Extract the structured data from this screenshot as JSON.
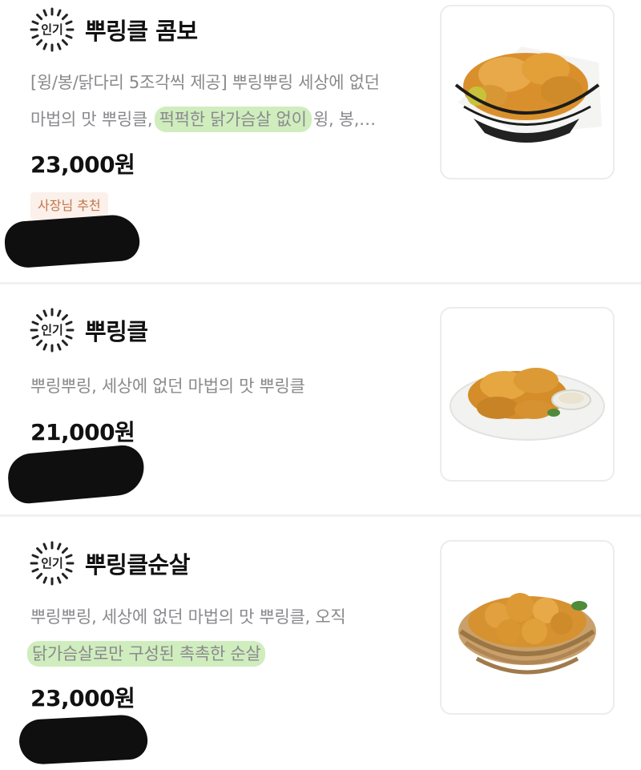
{
  "menu": {
    "items": [
      {
        "badge": "인기",
        "name": "뿌링클 콤보",
        "desc_lines": [
          "[윙/봉/닭다리 5조각씩 제공] 뿌링뿌링 세상에 없던",
          "마법의 맛 뿌링클, ",
          "퍽퍽한 닭가슴살 없이",
          " 윙, 봉,…"
        ],
        "price": "23,000원",
        "tag": "사장님 추천",
        "image_icon": "fried-chicken-basket-icon"
      },
      {
        "badge": "인기",
        "name": "뿌링클",
        "desc_lines": [
          "뿌링뿌링, 세상에 없던 마법의 맛 뿌링클"
        ],
        "price": "21,000원",
        "image_icon": "fried-chicken-plate-icon"
      },
      {
        "badge": "인기",
        "name": "뿌링클순살",
        "desc_lines": [
          "뿌링뿌링, 세상에 없던 마법의 맛 뿌링클, 오직",
          "닭가슴살로만 구성된 촉촉한 순살"
        ],
        "price": "23,000원",
        "image_icon": "boneless-chicken-basket-icon"
      }
    ]
  },
  "colors": {
    "highlight": "#96d66e",
    "badge_bg": "#fbf0ea",
    "badge_text": "#c0764a",
    "redaction": "#0f0f10"
  }
}
